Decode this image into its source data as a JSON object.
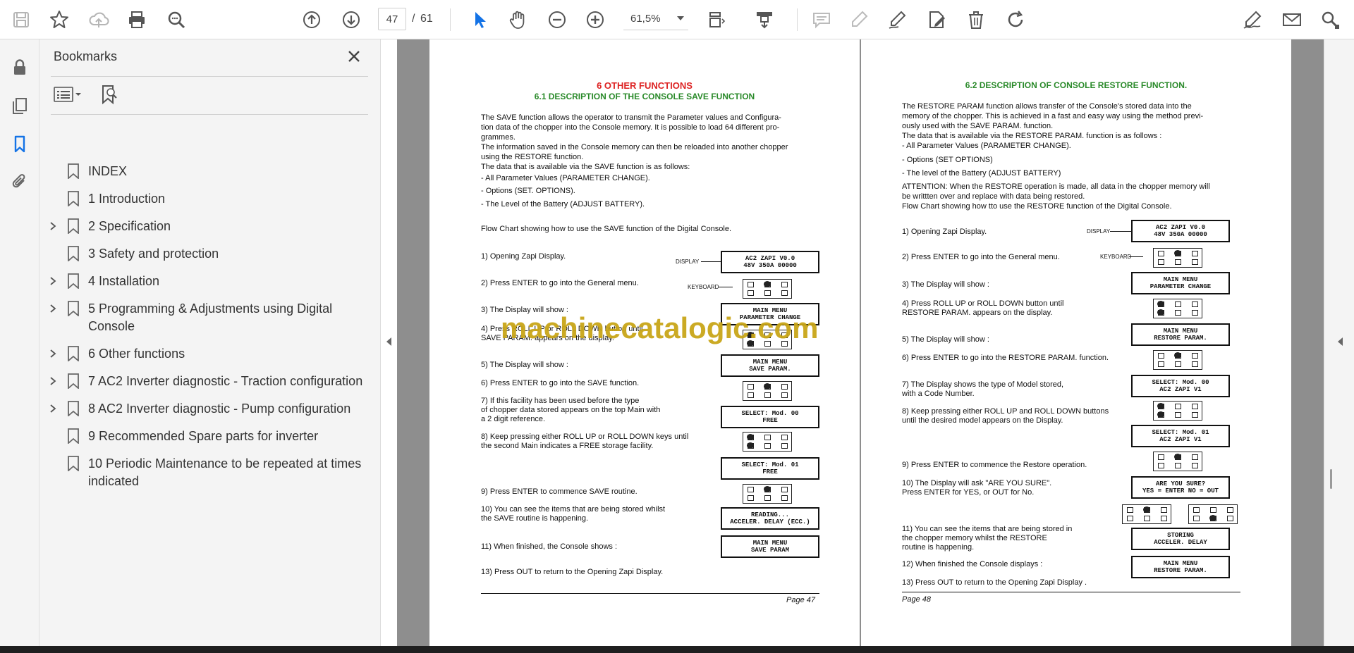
{
  "toolbar": {
    "page_current": "47",
    "page_separator": "/",
    "page_total": "61",
    "zoom": "61,5%",
    "icons": [
      "save-icon",
      "star-icon",
      "cloud-upload-icon",
      "print-icon",
      "zoom-search-icon",
      "page-up-icon",
      "page-down-icon",
      "select-cursor-icon",
      "hand-icon",
      "zoom-out-icon",
      "zoom-in-icon",
      "fit-page-icon",
      "scroll-mode-icon",
      "comment-icon",
      "highlight-icon",
      "draw-icon",
      "edit-icon",
      "delete-icon",
      "rotate-icon",
      "sign-icon",
      "mail-icon",
      "more-icon"
    ],
    "accent_color": "#1473e6"
  },
  "sidebar": {
    "icons": [
      "lock-icon",
      "pages-icon",
      "bookmark-icon",
      "attachment-icon"
    ]
  },
  "bookmarks": {
    "title": "Bookmarks",
    "items": [
      {
        "label": "INDEX",
        "expandable": false
      },
      {
        "label": "1 Introduction",
        "expandable": false
      },
      {
        "label": "2 Specification",
        "expandable": true
      },
      {
        "label": "3 Safety and protection",
        "expandable": false
      },
      {
        "label": "4 Installation",
        "expandable": true
      },
      {
        "label": "5 Programming & Adjustments using Digital Console",
        "expandable": true
      },
      {
        "label": "6 Other functions",
        "expandable": true
      },
      {
        "label": "7 AC2 Inverter diagnostic - Traction configuration",
        "expandable": true
      },
      {
        "label": "8 AC2 Inverter diagnostic - Pump configuration",
        "expandable": true
      },
      {
        "label": "9 Recommended Spare parts for inverter",
        "expandable": false
      },
      {
        "label": "10 Periodic Maintenance to be repeated at times indicated",
        "expandable": false
      }
    ]
  },
  "page47": {
    "heading": "6 OTHER FUNCTIONS",
    "subheading": "6.1 DESCRIPTION OF THE CONSOLE SAVE FUNCTION",
    "intro": "The  SAVE function allows the operator to transmit the Parameter values and Configura-\ntion data of the chopper into the Console memory.  It is possible to load 64 different pro-\ngrammes.\nThe information  saved in the Console memory can then be reloaded into another chopper\nusing the RESTORE function.\nThe data that is available via the SAVE function is as follows:",
    "bullets": [
      "-   All Parameter Values (PARAMETER CHANGE).",
      "-   Options (SET. OPTIONS).",
      "-   The Level of the Battery (ADJUST BATTERY)."
    ],
    "flow_title": "Flow Chart showing how to use the SAVE function of the Digital Console.",
    "steps": [
      "1)   Opening Zapi Display.",
      "2)   Press ENTER to go into the General menu.",
      "3)   The Display will show :",
      "4)   Press ROLL UP or ROLL DOWN button until\n       SAVE PARAM. appears on the display.",
      "5)   The Display will show :",
      "6)   Press ENTER to go into the  SAVE function.",
      "7)   If this facility has been used before the type\n       of chopper data stored appears on the top Main with\n       a 2 digit reference.",
      "8)   Keep pressing either  ROLL UP or ROLL DOWN  keys until\n       the second Main indicates a FREE storage facility.",
      "9)   Press ENTER to commence SAVE routine.",
      "10) You can see the items that are being stored whilst\n       the SAVE routine is happening.",
      "11) When finished, the Console shows :",
      "13) Press OUT to return to the Opening Zapi Display."
    ],
    "display_label": "DISPLAY",
    "keyboard_label": "KEYBOARD",
    "displays": [
      [
        "AC2  ZAPI  V0.0",
        "48V  350A  00000"
      ],
      [
        "MAIN  MENU",
        "PARAMETER  CHANGE"
      ],
      [
        "MAIN  MENU",
        "SAVE  PARAM."
      ],
      [
        "SELECT:  Mod.  00",
        "FREE"
      ],
      [
        "SELECT:  Mod.  01",
        "FREE"
      ],
      [
        "READING...",
        "ACCELER.  DELAY  (ECC.)"
      ],
      [
        "MAIN  MENU",
        "SAVE  PARAM"
      ]
    ],
    "footer": "Page 47"
  },
  "page48": {
    "subheading": "6.2 DESCRIPTION OF CONSOLE RESTORE FUNCTION.",
    "intro": "The RESTORE PARAM function allows transfer of the Console's stored data into the\nmemory of the chopper.  This is achieved in a fast and easy way using the method previ-\nously used with the SAVE PARAM. function.\nThe data that is available via the RESTORE PARAM. function is as follows :\n- All Parameter Values (PARAMETER CHANGE).",
    "bullets": [
      "- Options (SET OPTIONS)",
      "- The level of the Battery (ADJUST BATTERY)"
    ],
    "attention": "ATTENTION: When the RESTORE operation is made, all data in the chopper memory will\nbe writtten over and replace with data being restored.\nFlow Chart showing how tto use the RESTORE function of the Digital Console.",
    "steps": [
      "1)   Opening Zapi Display.",
      "2)   Press ENTER to go into the General menu.",
      "3)   The Display will show :",
      "4)   Press ROLL UP or ROLL DOWN  button until\n       RESTORE PARAM. appears on the display.",
      "5)   The Display will show :",
      "6)   Press ENTER to go into the RESTORE PARAM. function.",
      "7)   The Display shows the type of Model stored,\n       with a Code Number.",
      "8)   Keep pressing either ROLL UP and ROLL DOWN buttons\n       until the desired model appears on the Display.",
      "9)   Press ENTER to commence the Restore operation.",
      "10) The Display will ask \"ARE YOU SURE\".\n       Press  ENTER for YES, or  OUT for No.",
      "11) You can see the items that are being stored in\n       the chopper memory whilst the RESTORE\n       routine is happening.",
      "12) When finished the Console displays :",
      "13) Press OUT to return to the Opening Zapi Display ."
    ],
    "display_label": "DISPLAY",
    "keyboard_label": "KEYBOARD",
    "displays": [
      [
        "AC2  ZAPI  V0.0",
        "48V  350A  00000"
      ],
      [
        "MAIN  MENU",
        "PARAMETER  CHANGE"
      ],
      [
        "MAIN  MENU",
        "RESTORE  PARAM."
      ],
      [
        "SELECT:  Mod.  00",
        "AC2  ZAPI  V1"
      ],
      [
        "SELECT:  Mod.  01",
        "AC2  ZAPI  V1"
      ],
      [
        "ARE  YOU  SURE?",
        "YES  =  ENTER  NO  =  OUT"
      ],
      [
        "STORING",
        "ACCELER.  DELAY"
      ],
      [
        "MAIN  MENU",
        "RESTORE  PARAM."
      ]
    ],
    "footer": "Page 48"
  },
  "watermark": "machinecatalogic.com"
}
